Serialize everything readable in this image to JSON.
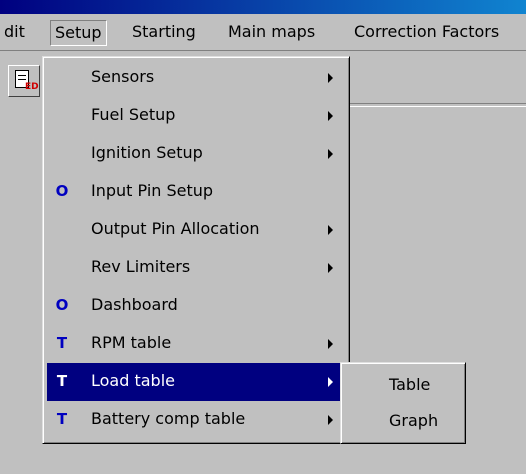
{
  "window": {
    "title": ""
  },
  "menubar": {
    "items": [
      {
        "label": "dit",
        "key": "edit"
      },
      {
        "label": "Setup",
        "key": "setup"
      },
      {
        "label": "Starting",
        "key": "starting"
      },
      {
        "label": "Main maps",
        "key": "main-maps"
      },
      {
        "label": "Correction Factors",
        "key": "correction-factors"
      }
    ]
  },
  "toolbar": {
    "doc_icon": "document-icon",
    "badge": "ED"
  },
  "setup_menu": {
    "items": [
      {
        "label": "Sensors",
        "mark": "",
        "submenu": true
      },
      {
        "label": "Fuel Setup",
        "mark": "",
        "submenu": true
      },
      {
        "label": "Ignition Setup",
        "mark": "",
        "submenu": true
      },
      {
        "label": "Input Pin Setup",
        "mark": "O",
        "submenu": false
      },
      {
        "label": "Output Pin Allocation",
        "mark": "",
        "submenu": true
      },
      {
        "label": "Rev Limiters",
        "mark": "",
        "submenu": true
      },
      {
        "label": "Dashboard",
        "mark": "O",
        "submenu": false
      },
      {
        "label": "RPM table",
        "mark": "T",
        "submenu": true
      },
      {
        "label": "Load table",
        "mark": "T",
        "submenu": true,
        "highlighted": true
      },
      {
        "label": "Battery comp table",
        "mark": "T",
        "submenu": true
      }
    ]
  },
  "load_table_submenu": {
    "items": [
      {
        "label": "Table"
      },
      {
        "label": "Graph"
      }
    ]
  },
  "colors": {
    "face": "#c0c0c0",
    "highlight": "#000080",
    "mark": "#0000c0"
  }
}
